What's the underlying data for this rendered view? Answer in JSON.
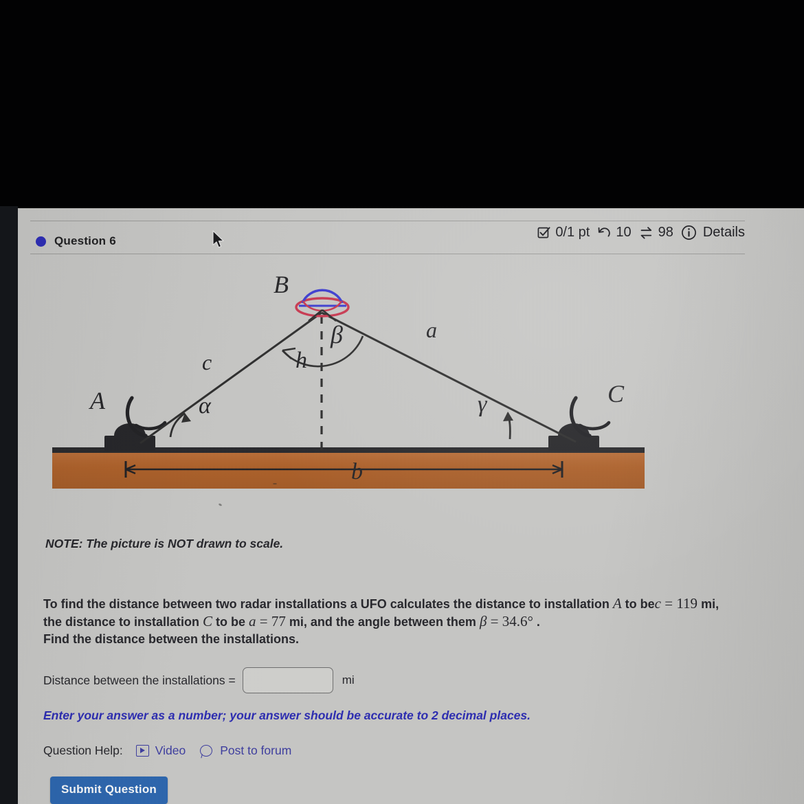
{
  "header": {
    "question_label": "Question 6",
    "bullet_color": "#2b2bb5",
    "points": "0/1 pt",
    "attempts_icon": "undo-arrow-icon",
    "attempts": "10",
    "retries_icon": "swap-arrows-icon",
    "retries": "98",
    "details_icon": "info-circle-icon",
    "details": "Details"
  },
  "diagram": {
    "alt": "Triangle ABC with UFO at apex B above ground, two radar installations at A and C",
    "vertex_a": "A",
    "vertex_b": "B",
    "vertex_c": "C",
    "side_c": "c",
    "side_a": "a",
    "side_b": "b",
    "height": "h",
    "angle_alpha": "α",
    "angle_beta": "β",
    "angle_gamma": "γ",
    "ufo_dome_color": "#3b3bd0",
    "ufo_saucer_color": "#c8374f",
    "ground_color": "#b5642a",
    "ground_edge_color": "#2a2a2a",
    "line_color": "#2d2d2d"
  },
  "note": "NOTE: The picture is NOT drawn to scale.",
  "problem": {
    "line1_a": "To find the distance between two radar installations a UFO calculates the distance to installation ",
    "line1_var": "A",
    "line1_b": "  to be",
    "line2_var1": "c",
    "line2_eq1": " = ",
    "line2_val1": "119",
    "line2_a": "  mi,  the distance to installation ",
    "line2_var2": "C",
    "line2_b": "  to be ",
    "line2_var3": "a",
    "line2_eq2": " = ",
    "line2_val2": "77",
    "line2_c": "   mi, and the angle between them ",
    "line2_var4": "β",
    "line2_eq3": " = ",
    "line2_val3": "34.6°",
    "line2_d": " .",
    "line3": "Find the distance between the installations."
  },
  "answer": {
    "label": "Distance between the installations =",
    "value": "",
    "placeholder": "",
    "unit": "mi"
  },
  "hint": "Enter your answer as a number; your answer should be accurate to 2 decimal places.",
  "help": {
    "label": "Question Help:",
    "video_icon": "play-box-icon",
    "video": "Video",
    "forum_icon": "speech-bubble-icon",
    "forum": "Post to forum"
  },
  "submit": {
    "label": "Submit Question",
    "color": "#2a64ac"
  }
}
